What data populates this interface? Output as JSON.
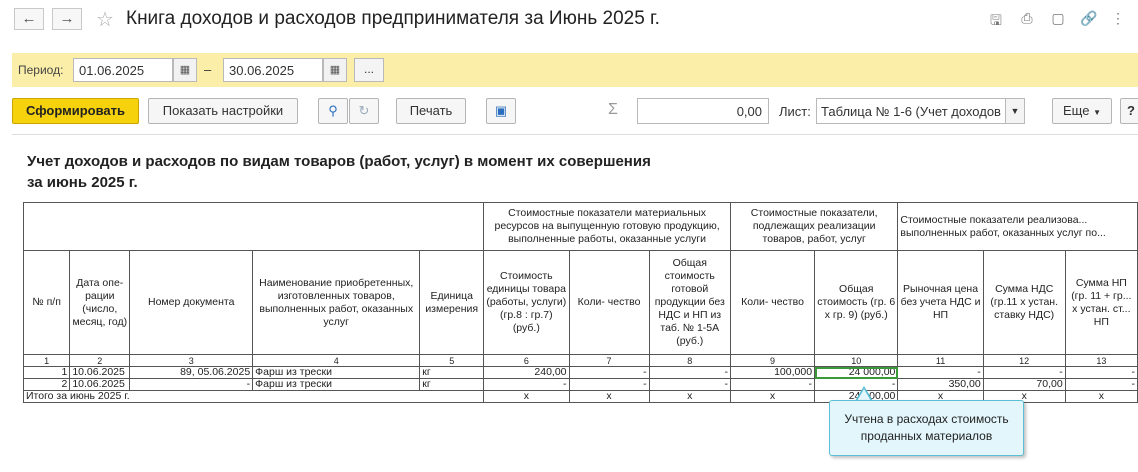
{
  "window": {
    "title": "Книга доходов и расходов предпринимателя за Июнь 2025 г.",
    "back_icon": "arrow-left-icon",
    "forward_icon": "arrow-right-icon"
  },
  "period": {
    "label": "Период:",
    "from": "01.06.2025",
    "to": "30.06.2025",
    "separator": "–",
    "more_label": "..."
  },
  "toolbar": {
    "generate_label": "Сформировать",
    "show_settings_label": "Показать настройки",
    "print_label": "Печать",
    "sum_value": "0,00",
    "sheet_label": "Лист:",
    "sheet_value": "Таблица № 1-6 (Учет доходов и",
    "more_label": "Еще",
    "help_label": "?"
  },
  "report": {
    "title_line1": "Учет доходов и расходов по видам товаров (работ, услуг) в момент их совершения",
    "title_line2": "за июнь 2025 г.",
    "group_headers": {
      "g1": "Стоимостные показатели материальных ресурсов на выпущенную готовую продукцию, выполненные работы, оказанные услуги",
      "g2": "Стоимостные показатели, подлежащих реализации товаров, работ, услуг",
      "g3": "Стоимостные показатели реализова... выполненных работ, оказанных услуг по..."
    },
    "columns": [
      "№ п/п",
      "Дата опе- рации (число, месяц, год)",
      "Номер документа",
      "Наименование приобретенных, изготовленных товаров, выполненных работ, оказанных услуг",
      "Единица измерения",
      "Стоимость единицы товара (работы, услуги) (гр.8 : гр.7) (руб.)",
      "Коли- чество",
      "Общая стоимость готовой продукции без НДС и НП из таб. № 1-5А (руб.)",
      "Коли- чество",
      "Общая стоимость (гр. 6 х гр. 9) (руб.)",
      "Рыночная цена без учета НДС и НП",
      "Сумма НДС (гр.11 х устан. ставку НДС)",
      "Сумма НП (гр. 11 + гр... х устан. ст... НП"
    ],
    "col_numbers": [
      "1",
      "2",
      "3",
      "4",
      "5",
      "6",
      "7",
      "8",
      "9",
      "10",
      "11",
      "12",
      "13"
    ],
    "rows": [
      [
        "1",
        "10.06.2025",
        "89, 05.06.2025",
        "Фарш из трески",
        "кг",
        "240,00",
        "-",
        "-",
        "100,000",
        "24 000,00",
        "-",
        "-",
        "-"
      ],
      [
        "2",
        "10.06.2025",
        "-",
        "Фарш из трески",
        "кг",
        "-",
        "-",
        "-",
        "-",
        "-",
        "350,00",
        "70,00",
        "-"
      ]
    ],
    "total": [
      "Итого за июнь 2025 г.",
      "х",
      "х",
      "х",
      "х",
      "24 000,00",
      "х",
      "х",
      "х"
    ]
  },
  "callout": {
    "text_line1": "Учтена в расходах стоимость",
    "text_line2": "проданных материалов"
  }
}
